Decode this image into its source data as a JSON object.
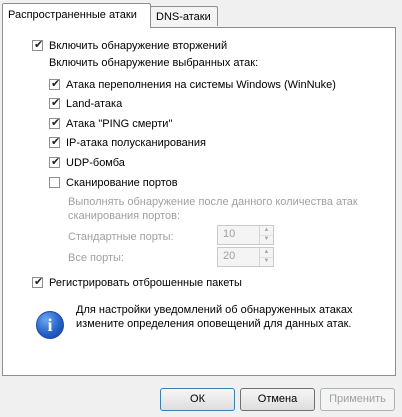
{
  "tabs": [
    {
      "label": "Распространенные атаки",
      "active": true
    },
    {
      "label": "DNS-атаки",
      "active": false
    }
  ],
  "intrusion_detection": {
    "label": "Включить обнаружение вторжений",
    "checked": true
  },
  "selected_attacks_heading": "Включить обнаружение выбранных атак:",
  "attacks": [
    {
      "label": "Атака переполнения на системы Windows (WinNuke)",
      "checked": true
    },
    {
      "label": "Land-атака",
      "checked": true
    },
    {
      "label": "Атака \"PING смерти\"",
      "checked": true
    },
    {
      "label": "IP-атака полусканирования",
      "checked": true
    },
    {
      "label": "UDP-бомба",
      "checked": true
    },
    {
      "label": "Сканирование портов",
      "checked": false
    }
  ],
  "port_scan": {
    "description": "Выполнять обнаружение после данного количества атак сканирования портов:",
    "standard_ports_label": "Стандартные порты:",
    "standard_ports_value": "10",
    "all_ports_label": "Все порты:",
    "all_ports_value": "20"
  },
  "log_dropped": {
    "label": "Регистрировать отброшенные пакеты",
    "checked": true
  },
  "info": {
    "icon": "info-icon",
    "text": "Для настройки уведомлений об обнаруженных атаках измените определения оповещений для данных атак."
  },
  "buttons": {
    "ok": "ОК",
    "cancel": "Отмена",
    "apply": "Применить"
  },
  "check_glyph": "✔"
}
